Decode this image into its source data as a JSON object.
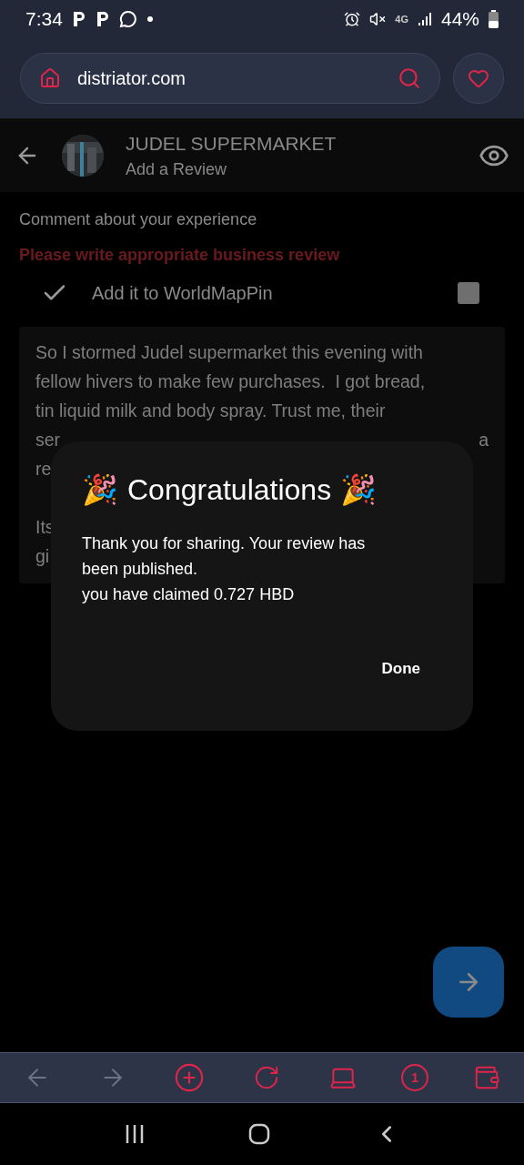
{
  "status_bar": {
    "time": "7:34",
    "network": "4G",
    "battery": "44%"
  },
  "browser": {
    "url": "distriator.com"
  },
  "header": {
    "title": "JUDEL SUPERMARKET",
    "subtitle": "Add a Review"
  },
  "form": {
    "label": "Comment about your experience",
    "error": "Please write appropriate business review",
    "worldmappin": {
      "label": "Add it to WorldMapPin",
      "checked": false
    },
    "review_paragraphs": [
      [
        {
          "left": "So I stormed Judel supermarket this evening with"
        },
        {
          "left": "fellow hivers to make few purchases.  I got bread,"
        },
        {
          "left": "tin liquid milk and body spray. Trust me, their"
        },
        {
          "left": "ser",
          "right": "a"
        },
        {
          "left": "re"
        }
      ],
      [
        {
          "left": "Its"
        },
        {
          "left": "gi"
        }
      ]
    ]
  },
  "dialog": {
    "title": "Congratulations",
    "emoji": "🎉",
    "message": "Thank you for sharing. Your review has been published.",
    "claim": "you have claimed 0.727 HBD",
    "button": "Done"
  },
  "toolbar": {
    "tab_count": "1"
  }
}
